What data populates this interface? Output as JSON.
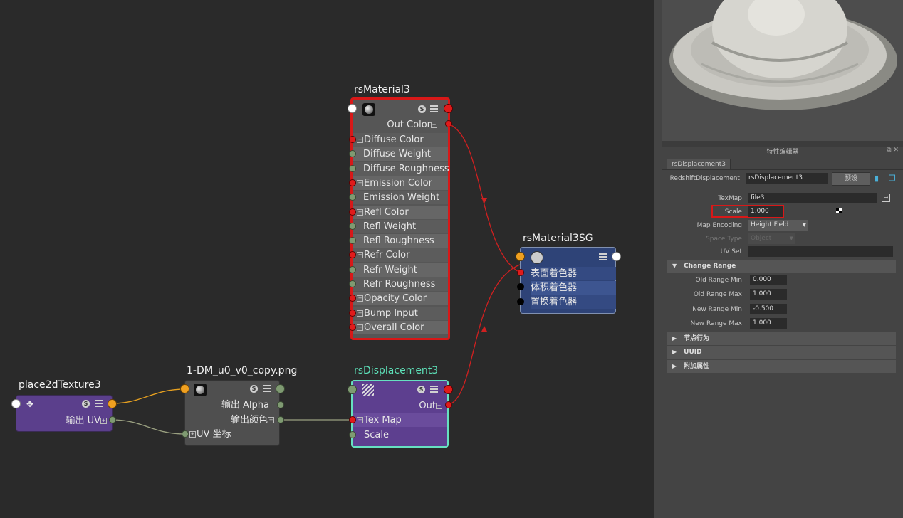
{
  "graph": {
    "rsMaterial": {
      "title": "rsMaterial3",
      "out_color": "Out Color",
      "inputs": [
        "Diffuse Color",
        "Diffuse Weight",
        "Diffuse Roughness",
        "Emission Color",
        "Emission Weight",
        "Refl Color",
        "Refl Weight",
        "Refl Roughness",
        "Refr Color",
        "Refr Weight",
        "Refr Roughness",
        "Opacity Color",
        "Bump Input",
        "Overall Color"
      ]
    },
    "rsMaterialSG": {
      "title": "rsMaterial3SG",
      "inputs": [
        "表面着色器",
        "体积着色器",
        "置换着色器"
      ]
    },
    "place2d": {
      "title": "place2dTexture3",
      "out_uv": "输出 UV"
    },
    "file": {
      "title": "1-DM_u0_v0_copy.png",
      "out_alpha": "输出 Alpha",
      "out_color": "输出颜色",
      "uv": "UV 坐标"
    },
    "rsDisplacement": {
      "title": "rsDisplacement3",
      "out": "Out",
      "tex_map": "Tex Map",
      "scale": "Scale"
    },
    "colors": {
      "material_border": "#d81818",
      "sg_body": "#2e4377",
      "place_body": "#5b3f8c",
      "disp_body": "#5d3f8f",
      "disp_border": "#66e0c0",
      "file_body": "#4f4f4f"
    }
  },
  "attr_editor": {
    "title": "特性编辑器",
    "tab": "rsDisplacement3",
    "node_type_label": "RedshiftDisplacement:",
    "node_name": "rsDisplacement3",
    "preset_button": "预设",
    "texmap_label": "TexMap",
    "texmap_value": "file3",
    "scale_label": "Scale",
    "scale_value": "1.000",
    "map_encoding_label": "Map Encoding",
    "map_encoding_value": "Height Field",
    "space_type_label": "Space Type",
    "space_type_value": "Object",
    "uv_set_label": "UV Set",
    "uv_set_value": "",
    "change_range_label": "Change Range",
    "old_min_label": "Old Range Min",
    "old_min_value": "0.000",
    "old_max_label": "Old Range Max",
    "old_max_value": "1.000",
    "new_min_label": "New Range Min",
    "new_min_value": "-0.500",
    "new_max_label": "New Range Max",
    "new_max_value": "1.000",
    "section_node_behavior": "节点行为",
    "section_uuid": "UUID",
    "section_extra": "附加属性"
  }
}
